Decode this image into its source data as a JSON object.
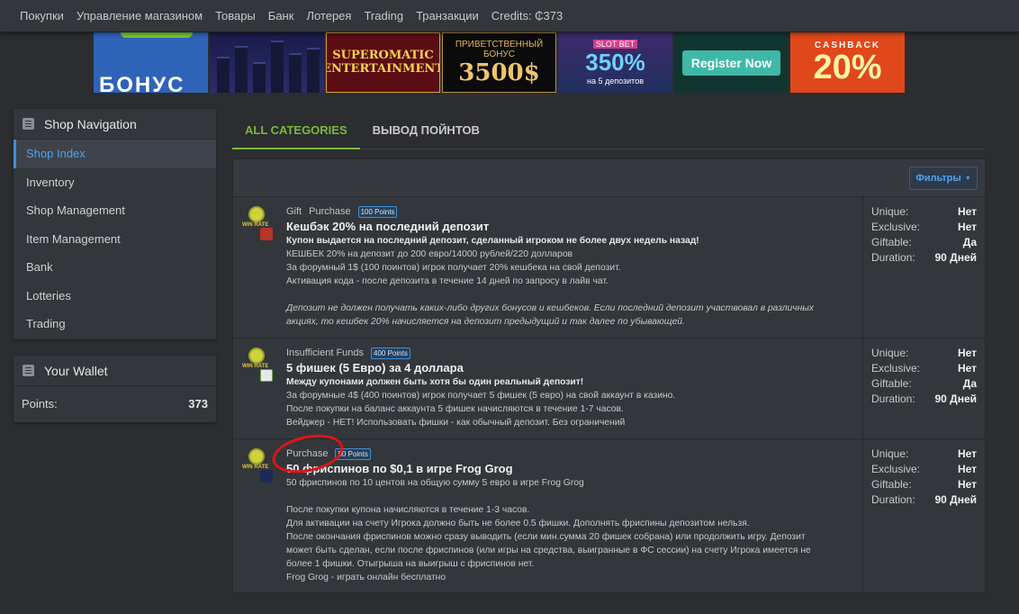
{
  "topnav": [
    "Покупки",
    "Управление магазином",
    "Товары",
    "Банк",
    "Лотерея",
    "Trading",
    "Транзакции",
    "Credits: ₵373"
  ],
  "banners": {
    "b3": "SUPEROMATIC ENTERTAINMENT",
    "b4_line1": "ПРИВЕТСТВЕННЫЙ",
    "b4_line2": "БОНУС",
    "b4_amount": "3500$",
    "b5_brand": "SLOT BET",
    "b5_amount": "350%",
    "b5_sub": "на 5 депозитов",
    "b6_button": "Register Now",
    "b7_top": "CASHBACK",
    "b7_amount": "20%"
  },
  "sidebar": {
    "title": "Shop Navigation",
    "items": [
      {
        "label": "Shop Index"
      },
      {
        "label": "Inventory"
      },
      {
        "label": "Shop Management"
      },
      {
        "label": "Item Management"
      },
      {
        "label": "Bank"
      },
      {
        "label": "Lotteries"
      },
      {
        "label": "Trading"
      }
    ]
  },
  "wallet": {
    "title": "Your Wallet",
    "points_label": "Points:",
    "points_value": "373"
  },
  "tabs": [
    "ALL CATEGORIES",
    "ВЫВОД ПОЙНТОВ"
  ],
  "filter_label": "Фильтры",
  "meta_labels": {
    "unique": "Unique:",
    "exclusive": "Exclusive:",
    "giftable": "Giftable:",
    "duration": "Duration:"
  },
  "items": [
    {
      "tags": [
        "Gift",
        "Purchase"
      ],
      "badge": "100 Points",
      "title": "Кешбэк 20% на последний депозит",
      "lines": {
        "l1": "Купон выдается на последний депозит, сделанный игроком не более двух недель назад!",
        "l2": "КЕШБЕК 20% на депозит до 200 евро/14000 рублей/220 долларов",
        "l3": "За форумный 1$ (100 поинтов) игрок получает 20% кешбека на свой депозит.",
        "l4": "Активация кода - после депозита в течение 14 дней по запросу в лайв чат.",
        "l5": "Депозит не должен получать каких-либо других бонусов и кешбеков. Если последний депозит участвовал в различных",
        "l6": "акциях, то кешбек 20% начисляется на депозит предыдущий и так далее по убывающей."
      },
      "unique": "Нет",
      "exclusive": "Нет",
      "giftable": "Да",
      "duration": "90 Дней"
    },
    {
      "tags": [
        "Insufficient Funds"
      ],
      "badge": "400 Points",
      "title": "5 фишек (5 Евро) за 4 доллара",
      "lines": {
        "l1": "Между купонами должен быть хотя бы один реальный депозит!",
        "l2": "За форумные 4$ (400 поинтов) игрок получает 5 фишек (5 евро) на свой аккаунт в казино.",
        "l3": "После покупки на баланс аккаунта 5 фишек начисляются в течение 1-7 часов.",
        "l4": "Вейджер - НЕТ! Использовать фишки - как обычный депозит. Без ограничений"
      },
      "unique": "Нет",
      "exclusive": "Нет",
      "giftable": "Да",
      "duration": "90 Дней"
    },
    {
      "tags": [
        "Purchase"
      ],
      "badge": "50 Points",
      "title": "50 фриспинов по $0,1 в игре Frog Grog",
      "lines": {
        "l1": "50 фриспинов по 10 центов на общую сумму 5 евро в игре Frog Grog",
        "l2": "После покупки купона начисляются в течение 1-3 часов.",
        "l3": "Для активации на счету Игрока должно быть не более 0.5 фишки. Дополнять фриспины депозитом нельзя.",
        "l4": "После окончания фриспинов можно сразу выводить (если мин.сумма 20 фишек собрана) или продолжить игру. Депозит",
        "l5": "может быть сделан, если после фриспинов (или игры на средства, выигранные в ФС сессии) на счету Игрока имеется не",
        "l6": "более 1 фишки. Отыгрыша на выигрыш с фриспинов нет.",
        "l7": "Frog Grog - играть онлайн бесплатно"
      },
      "unique": "Нет",
      "exclusive": "Нет",
      "giftable": "Нет",
      "duration": "90 Дней"
    }
  ],
  "thumb_label": "WIN RATE",
  "colors": {
    "accent_blue": "#4da3f0",
    "accent_green": "#7ab93a",
    "annotation_red": "#e11414"
  }
}
